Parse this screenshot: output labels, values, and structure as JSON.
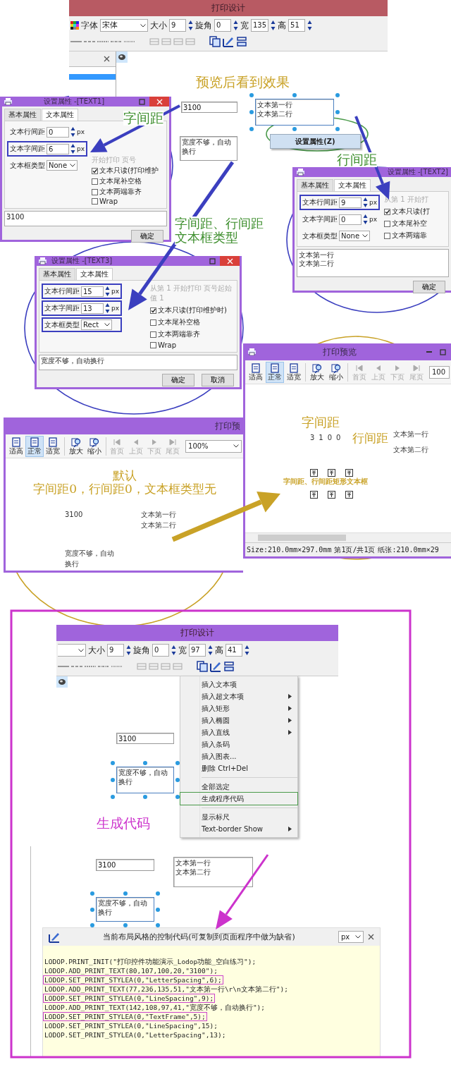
{
  "design_windows": [
    {
      "title": "打印设计",
      "color": "#b85a63",
      "font": {
        "label": "字体",
        "value": "宋体"
      },
      "fields": [
        {
          "label": "大小",
          "value": "9"
        },
        {
          "label": "旋角",
          "value": "0"
        },
        {
          "label": "宽",
          "value": "135"
        },
        {
          "label": "高",
          "value": "51"
        }
      ],
      "side_panel": true,
      "items": [
        {
          "kind": "field",
          "lines": [
            "3100"
          ],
          "selected": false
        },
        {
          "kind": "textbox",
          "lines": [
            "文本第一行",
            "文本第二行"
          ],
          "selected": true
        },
        {
          "kind": "textbox",
          "lines": [
            "宽度不够，自动",
            "换行"
          ],
          "selected": false
        }
      ],
      "popup_item": "设置属性(Z)"
    },
    {
      "title": "打印设计",
      "color": "#a064dc",
      "fields": [
        {
          "label": "大小",
          "value": "9"
        },
        {
          "label": "旋角",
          "value": "0"
        },
        {
          "label": "宽",
          "value": "97"
        },
        {
          "label": "高",
          "value": "41"
        }
      ],
      "side_panel": false,
      "items": [
        {
          "kind": "field",
          "lines": [
            "3100"
          ],
          "selected": false
        },
        {
          "kind": "textbox",
          "lines": [
            "宽度不够，自动",
            "换行"
          ],
          "selected": true
        }
      ]
    }
  ],
  "dialogs": [
    {
      "title": "设置属性 -[TEXT1]",
      "controls": true,
      "tabs": [
        {
          "label": "基本属性",
          "selected": false
        },
        {
          "label": "文本属性",
          "selected": true
        }
      ],
      "fields": [
        {
          "kind": "number",
          "label": "文本行间距",
          "value": "0",
          "unit": "px",
          "highlighted": false
        },
        {
          "kind": "number",
          "label": "文本字间距",
          "value": "6",
          "unit": "px",
          "highlighted": true
        },
        {
          "kind": "select",
          "label": "文本框类型",
          "value": "None",
          "highlighted": false
        }
      ],
      "hint": "开始打印 页号",
      "checks": [
        {
          "label": "文本只读(打印维护",
          "checked": true
        },
        {
          "label": "文本尾补空格",
          "checked": false
        },
        {
          "label": "文本两端靠齐",
          "checked": false
        },
        {
          "label": "Wrap",
          "checked": false
        }
      ],
      "memo": [
        "3100"
      ],
      "buttons": [
        "确定"
      ]
    },
    {
      "title": "设置属性 -[TEXT2]",
      "controls": false,
      "tabs": [
        {
          "label": "基本属性",
          "selected": false
        },
        {
          "label": "文本属性",
          "selected": true
        }
      ],
      "fields": [
        {
          "kind": "number",
          "label": "文本行间距",
          "value": "9",
          "unit": "px",
          "highlighted": true
        },
        {
          "kind": "number",
          "label": "文本字间距",
          "value": "0",
          "unit": "px",
          "highlighted": false
        },
        {
          "kind": "select",
          "label": "文本框类型",
          "value": "None",
          "highlighted": false
        }
      ],
      "hint": "从第 1  开始打",
      "checks": [
        {
          "label": "文本只读(打",
          "checked": true
        },
        {
          "label": "文本尾补空",
          "checked": false
        },
        {
          "label": "文本两端靠",
          "checked": false
        }
      ],
      "memo": [
        "文本第一行",
        "文本第二行"
      ],
      "buttons": [
        "确定"
      ]
    },
    {
      "title": "设置属性 -[TEXT3]",
      "controls": true,
      "tabs": [
        {
          "label": "基本属性",
          "selected": false
        },
        {
          "label": "文本属性",
          "selected": true
        }
      ],
      "fields": [
        {
          "kind": "number",
          "label": "文本行间距",
          "value": "15",
          "unit": "px",
          "highlighted": true
        },
        {
          "kind": "number",
          "label": "文本字间距",
          "value": "13",
          "unit": "px",
          "highlighted": true
        },
        {
          "kind": "select",
          "label": "文本框类型",
          "value": "Rect",
          "highlighted": true
        }
      ],
      "hint": "从第 1  开始打印  页号起始值 1",
      "checks": [
        {
          "label": "文本只读(打印维护时)",
          "checked": true
        },
        {
          "label": "文本尾补空格",
          "checked": false
        },
        {
          "label": "文本两端靠齐",
          "checked": false
        },
        {
          "label": "Wrap",
          "checked": false
        }
      ],
      "memo": [
        "宽度不够，自动换行"
      ],
      "buttons": [
        "确定",
        "取消"
      ]
    }
  ],
  "previews": [
    {
      "title": "打印预",
      "controls": false,
      "toolbar": [
        {
          "kind": "page",
          "label": "适高",
          "selected": false,
          "disabled": false,
          "separator_before": false
        },
        {
          "kind": "page",
          "label": "正常",
          "selected": true,
          "disabled": false,
          "separator_before": false
        },
        {
          "kind": "page",
          "label": "适宽",
          "selected": false,
          "disabled": false,
          "separator_before": false
        },
        {
          "kind": "zoom",
          "label": "放大",
          "selected": false,
          "disabled": false,
          "separator_before": true
        },
        {
          "kind": "zoom",
          "label": "缩小",
          "selected": false,
          "disabled": false,
          "separator_before": false
        },
        {
          "kind": "first",
          "label": "首页",
          "selected": false,
          "disabled": true,
          "separator_before": true
        },
        {
          "kind": "prev",
          "label": "上页",
          "selected": false,
          "disabled": true,
          "separator_before": false
        },
        {
          "kind": "next",
          "label": "下页",
          "selected": false,
          "disabled": true,
          "separator_before": false
        },
        {
          "kind": "last",
          "label": "尾页",
          "selected": false,
          "disabled": true,
          "separator_before": false
        }
      ],
      "zoom": "100%",
      "items": [
        {
          "kind": "text",
          "lines": [
            "3100"
          ]
        },
        {
          "kind": "text",
          "lines": [
            "文本第一行",
            "文本第二行"
          ]
        },
        {
          "kind": "text",
          "lines": [
            "宽度不够，自动",
            "换行"
          ]
        }
      ]
    },
    {
      "title": "打印预览",
      "controls": true,
      "toolbar": [
        {
          "kind": "page",
          "label": "适高",
          "selected": false,
          "disabled": false,
          "separator_before": false
        },
        {
          "kind": "page",
          "label": "正常",
          "selected": true,
          "disabled": false,
          "separator_before": false
        },
        {
          "kind": "page",
          "label": "适宽",
          "selected": false,
          "disabled": false,
          "separator_before": false
        },
        {
          "kind": "zoom",
          "label": "放大",
          "selected": false,
          "disabled": false,
          "separator_before": true
        },
        {
          "kind": "zoom",
          "label": "缩小",
          "selected": false,
          "disabled": false,
          "separator_before": false
        },
        {
          "kind": "first",
          "label": "首页",
          "selected": false,
          "disabled": true,
          "separator_before": true
        },
        {
          "kind": "prev",
          "label": "上页",
          "selected": false,
          "disabled": true,
          "separator_before": false
        },
        {
          "kind": "next",
          "label": "下页",
          "selected": false,
          "disabled": true,
          "separator_before": false
        },
        {
          "kind": "last",
          "label": "尾页",
          "selected": false,
          "disabled": true,
          "separator_before": false
        }
      ],
      "zoom": "100",
      "items": [
        {
          "kind": "spaced",
          "lines": [
            "3100"
          ]
        },
        {
          "kind": "wide_lines",
          "lines": [
            "文本第一行",
            "文本第二行"
          ]
        },
        {
          "kind": "glyphs"
        }
      ],
      "status": [
        "Size:210.0mm×297.0mm",
        "第1页/共1页",
        "纸张:210.0mm×29"
      ]
    }
  ],
  "annotations": [
    {
      "lines": [
        "预览后看到效果"
      ],
      "color": "#c9a227"
    },
    {
      "lines": [
        "字间距"
      ],
      "color": "#3f8f2f"
    },
    {
      "lines": [
        "行间距"
      ],
      "color": "#3f8f2f"
    },
    {
      "lines": [
        "字间距、行间距",
        "文本框类型"
      ],
      "color": "#3f8f2f"
    },
    {
      "lines": [
        "字间距"
      ],
      "color": "#c9a227"
    },
    {
      "lines": [
        "行间距"
      ],
      "color": "#c9a227"
    },
    {
      "lines": [
        "默认",
        "字间距0，行间距0，文本框类型无"
      ],
      "color": "#c9a227"
    },
    {
      "lines": [
        "字间距、行间距矩形文本框"
      ],
      "color": "#c9a227"
    },
    {
      "lines": [
        "生成代码"
      ],
      "color": "#cc33cc"
    }
  ],
  "context_menu": [
    {
      "label": "插入文本项",
      "submenu": false,
      "separator_before": false,
      "highlighted": false
    },
    {
      "label": "插入超文本项",
      "submenu": true,
      "separator_before": false,
      "highlighted": false
    },
    {
      "label": "插入矩形",
      "submenu": true,
      "separator_before": false,
      "highlighted": false
    },
    {
      "label": "插入椭圆",
      "submenu": true,
      "separator_before": false,
      "highlighted": false
    },
    {
      "label": "插入直线",
      "submenu": true,
      "separator_before": false,
      "highlighted": false
    },
    {
      "label": "插入条码",
      "submenu": false,
      "separator_before": false,
      "highlighted": false
    },
    {
      "label": "插入图表...",
      "submenu": false,
      "separator_before": false,
      "highlighted": false
    },
    {
      "label": "删除  Ctrl+Del",
      "submenu": false,
      "separator_before": false,
      "highlighted": false
    },
    {
      "label": "全部选定",
      "submenu": false,
      "separator_before": true,
      "highlighted": false
    },
    {
      "label": "生成程序代码",
      "submenu": false,
      "separator_before": false,
      "highlighted": true
    },
    {
      "label": "显示标尺",
      "submenu": false,
      "separator_before": true,
      "highlighted": false
    },
    {
      "label": "Text-border Show",
      "submenu": true,
      "separator_before": false,
      "highlighted": false
    }
  ],
  "code_canvas": {
    "items": [
      {
        "kind": "field",
        "lines": [
          "3100"
        ],
        "selected": false
      },
      {
        "kind": "textbox",
        "lines": [
          "文本第一行",
          "文本第二行"
        ],
        "selected": false
      },
      {
        "kind": "textbox",
        "lines": [
          "宽度不够，自动",
          "换行"
        ],
        "selected": true
      }
    ]
  },
  "code_window": {
    "title": "当前布局风格的控制代码(可复制到页面程序中做为缺省)",
    "unit": "px",
    "lines": [
      {
        "text": "LODOP.PRINT_INIT(\"打印控件功能演示_Lodop功能_空白练习\");",
        "highlighted": false
      },
      {
        "text": "LODOP.ADD_PRINT_TEXT(80,107,100,20,\"3100\");",
        "highlighted": false
      },
      {
        "text": "LODOP.SET_PRINT_STYLEA(0,\"LetterSpacing\",6);",
        "highlighted": true
      },
      {
        "text": "LODOP.ADD_PRINT_TEXT(77,236,135,51,\"文本第一行\\r\\n文本第二行\");",
        "highlighted": false
      },
      {
        "text": "LODOP.SET_PRINT_STYLEA(0,\"LineSpacing\",9);",
        "highlighted": true
      },
      {
        "text": "LODOP.ADD_PRINT_TEXT(142,108,97,41,\"宽度不够，自动换行\");",
        "highlighted": false
      },
      {
        "text": "LODOP.SET_PRINT_STYLEA(0,\"TextFrame\",5);",
        "highlighted": true
      },
      {
        "text": "LODOP.SET_PRINT_STYLEA(0,\"LineSpacing\",15);",
        "highlighted": false
      },
      {
        "text": "LODOP.SET_PRINT_STYLEA(0,\"LetterSpacing\",13);",
        "highlighted": false
      }
    ]
  }
}
